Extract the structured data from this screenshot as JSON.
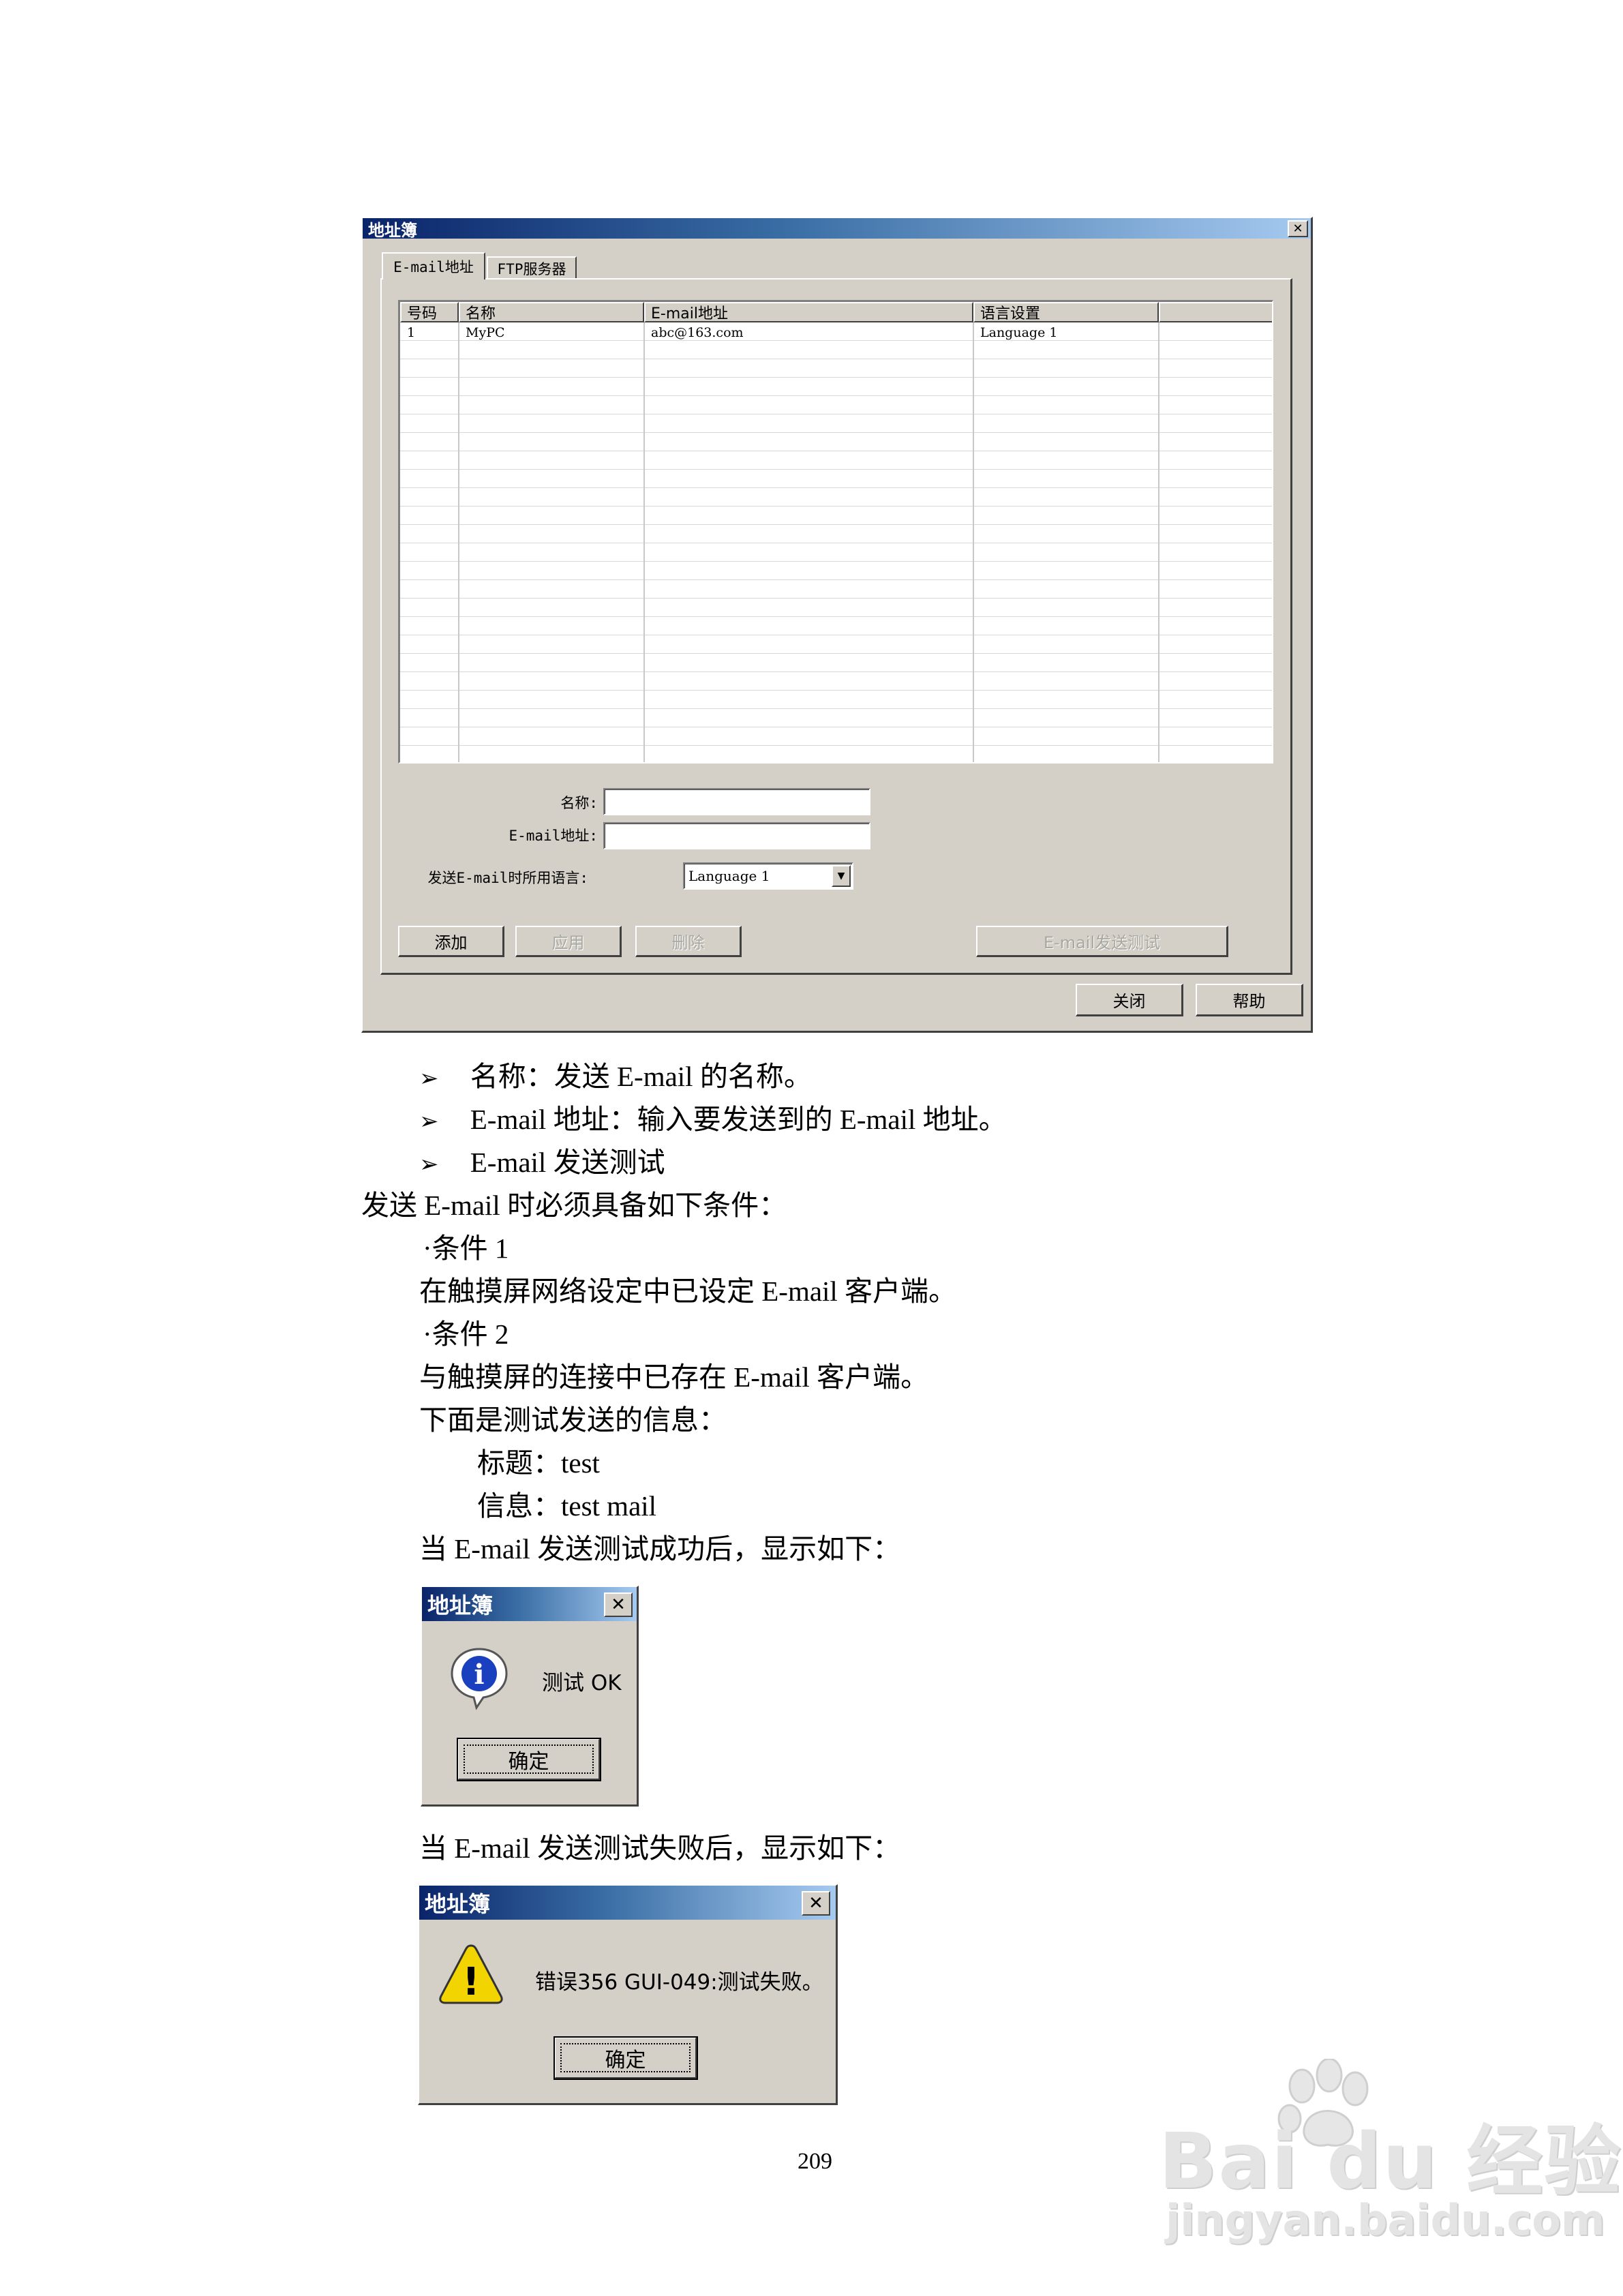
{
  "dialog": {
    "title": "地址簿",
    "close_glyph": "✕",
    "tabs": [
      "E-mail地址",
      "FTP服务器"
    ],
    "table": {
      "columns": [
        "号码",
        "名称",
        "E-mail地址",
        "语言设置",
        ""
      ],
      "rows": [
        [
          "1",
          "MyPC",
          "abc@163.com",
          "Language 1",
          ""
        ]
      ]
    },
    "form": {
      "name_label": "名称:",
      "name_value": "",
      "email_label": "E-mail地址:",
      "email_value": "",
      "language_label": "发送E-mail时所用语言:",
      "language_value": "Language 1",
      "dropdown_glyph": "▼"
    },
    "buttons": {
      "add": "添加",
      "apply": "应用",
      "delete": "删除",
      "test": "E-mail发送测试",
      "close": "关闭",
      "help": "帮助"
    }
  },
  "doc": {
    "bullet_glyph": "➢",
    "bullets": [
      "名称：发送 E-mail 的名称。",
      "E-mail 地址：输入要发送到的 E-mail 地址。",
      "E-mail 发送测试"
    ],
    "intro": "发送 E-mail 时必须具备如下条件：",
    "cond1_title": "·条件 1",
    "cond1_text": "在触摸屏网络设定中已设定 E-mail 客户端。",
    "cond2_title": "·条件 2",
    "cond2_text": "与触摸屏的连接中已存在 E-mail 客户端。",
    "test_intro": "下面是测试发送的信息：",
    "subject": "标题：test",
    "message": "信息：test mail",
    "success_intro": "当 E-mail 发送测试成功后，显示如下：",
    "fail_intro": "当 E-mail 发送测试失败后，显示如下："
  },
  "success_dialog": {
    "title": "地址簿",
    "close_glyph": "✕",
    "icon_glyph": "i",
    "message": "测试 OK",
    "ok": "确定"
  },
  "fail_dialog": {
    "title": "地址簿",
    "close_glyph": "✕",
    "icon_glyph": "!",
    "message": "错误356 GUI-049:测试失败。",
    "ok": "确定"
  },
  "page_number": "209",
  "watermark": {
    "brand": "Bai du 经验",
    "url": "jingyan.baidu.com"
  },
  "colors": {
    "window_bg": "#d4d0c8",
    "titlebar_start": "#0a246a",
    "titlebar_end": "#a6caf0",
    "info_icon": "#1a3fbf",
    "warning_icon": "#f2d400"
  }
}
